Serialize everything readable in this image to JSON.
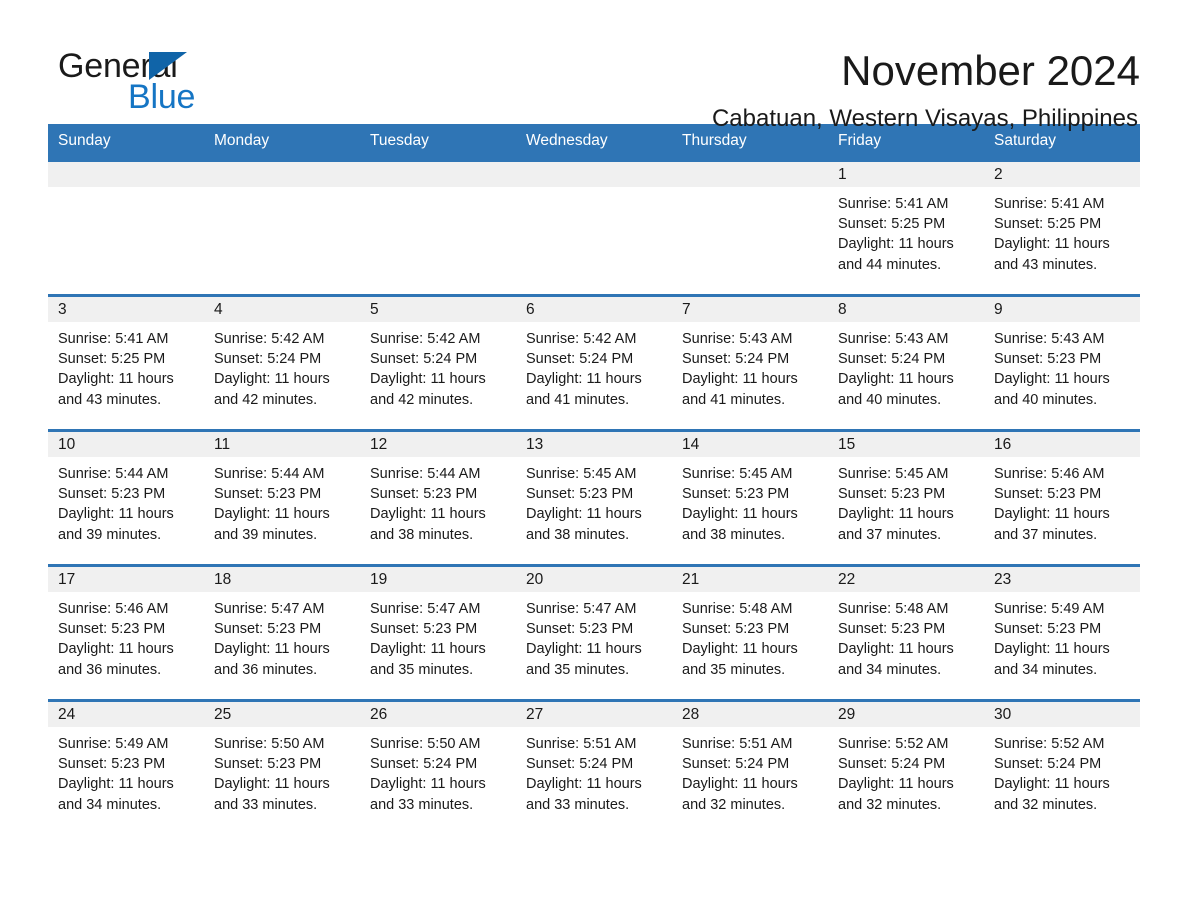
{
  "logo": {
    "text_top": "General",
    "text_bottom": "Blue",
    "triangle_color": "#1064a8",
    "blue_color": "#1575c4"
  },
  "header": {
    "month_title": "November 2024",
    "location": "Cabatuan, Western Visayas, Philippines"
  },
  "theme": {
    "header_blue": "#2f75b5",
    "daynum_band": "#f0f0f0",
    "text": "#1a1a1a"
  },
  "weekdays": [
    "Sunday",
    "Monday",
    "Tuesday",
    "Wednesday",
    "Thursday",
    "Friday",
    "Saturday"
  ],
  "weeks": [
    [
      {
        "day": "",
        "lines": []
      },
      {
        "day": "",
        "lines": []
      },
      {
        "day": "",
        "lines": []
      },
      {
        "day": "",
        "lines": []
      },
      {
        "day": "",
        "lines": []
      },
      {
        "day": "1",
        "lines": [
          "Sunrise: 5:41 AM",
          "Sunset: 5:25 PM",
          "Daylight: 11 hours",
          "and 44 minutes."
        ]
      },
      {
        "day": "2",
        "lines": [
          "Sunrise: 5:41 AM",
          "Sunset: 5:25 PM",
          "Daylight: 11 hours",
          "and 43 minutes."
        ]
      }
    ],
    [
      {
        "day": "3",
        "lines": [
          "Sunrise: 5:41 AM",
          "Sunset: 5:25 PM",
          "Daylight: 11 hours",
          "and 43 minutes."
        ]
      },
      {
        "day": "4",
        "lines": [
          "Sunrise: 5:42 AM",
          "Sunset: 5:24 PM",
          "Daylight: 11 hours",
          "and 42 minutes."
        ]
      },
      {
        "day": "5",
        "lines": [
          "Sunrise: 5:42 AM",
          "Sunset: 5:24 PM",
          "Daylight: 11 hours",
          "and 42 minutes."
        ]
      },
      {
        "day": "6",
        "lines": [
          "Sunrise: 5:42 AM",
          "Sunset: 5:24 PM",
          "Daylight: 11 hours",
          "and 41 minutes."
        ]
      },
      {
        "day": "7",
        "lines": [
          "Sunrise: 5:43 AM",
          "Sunset: 5:24 PM",
          "Daylight: 11 hours",
          "and 41 minutes."
        ]
      },
      {
        "day": "8",
        "lines": [
          "Sunrise: 5:43 AM",
          "Sunset: 5:24 PM",
          "Daylight: 11 hours",
          "and 40 minutes."
        ]
      },
      {
        "day": "9",
        "lines": [
          "Sunrise: 5:43 AM",
          "Sunset: 5:23 PM",
          "Daylight: 11 hours",
          "and 40 minutes."
        ]
      }
    ],
    [
      {
        "day": "10",
        "lines": [
          "Sunrise: 5:44 AM",
          "Sunset: 5:23 PM",
          "Daylight: 11 hours",
          "and 39 minutes."
        ]
      },
      {
        "day": "11",
        "lines": [
          "Sunrise: 5:44 AM",
          "Sunset: 5:23 PM",
          "Daylight: 11 hours",
          "and 39 minutes."
        ]
      },
      {
        "day": "12",
        "lines": [
          "Sunrise: 5:44 AM",
          "Sunset: 5:23 PM",
          "Daylight: 11 hours",
          "and 38 minutes."
        ]
      },
      {
        "day": "13",
        "lines": [
          "Sunrise: 5:45 AM",
          "Sunset: 5:23 PM",
          "Daylight: 11 hours",
          "and 38 minutes."
        ]
      },
      {
        "day": "14",
        "lines": [
          "Sunrise: 5:45 AM",
          "Sunset: 5:23 PM",
          "Daylight: 11 hours",
          "and 38 minutes."
        ]
      },
      {
        "day": "15",
        "lines": [
          "Sunrise: 5:45 AM",
          "Sunset: 5:23 PM",
          "Daylight: 11 hours",
          "and 37 minutes."
        ]
      },
      {
        "day": "16",
        "lines": [
          "Sunrise: 5:46 AM",
          "Sunset: 5:23 PM",
          "Daylight: 11 hours",
          "and 37 minutes."
        ]
      }
    ],
    [
      {
        "day": "17",
        "lines": [
          "Sunrise: 5:46 AM",
          "Sunset: 5:23 PM",
          "Daylight: 11 hours",
          "and 36 minutes."
        ]
      },
      {
        "day": "18",
        "lines": [
          "Sunrise: 5:47 AM",
          "Sunset: 5:23 PM",
          "Daylight: 11 hours",
          "and 36 minutes."
        ]
      },
      {
        "day": "19",
        "lines": [
          "Sunrise: 5:47 AM",
          "Sunset: 5:23 PM",
          "Daylight: 11 hours",
          "and 35 minutes."
        ]
      },
      {
        "day": "20",
        "lines": [
          "Sunrise: 5:47 AM",
          "Sunset: 5:23 PM",
          "Daylight: 11 hours",
          "and 35 minutes."
        ]
      },
      {
        "day": "21",
        "lines": [
          "Sunrise: 5:48 AM",
          "Sunset: 5:23 PM",
          "Daylight: 11 hours",
          "and 35 minutes."
        ]
      },
      {
        "day": "22",
        "lines": [
          "Sunrise: 5:48 AM",
          "Sunset: 5:23 PM",
          "Daylight: 11 hours",
          "and 34 minutes."
        ]
      },
      {
        "day": "23",
        "lines": [
          "Sunrise: 5:49 AM",
          "Sunset: 5:23 PM",
          "Daylight: 11 hours",
          "and 34 minutes."
        ]
      }
    ],
    [
      {
        "day": "24",
        "lines": [
          "Sunrise: 5:49 AM",
          "Sunset: 5:23 PM",
          "Daylight: 11 hours",
          "and 34 minutes."
        ]
      },
      {
        "day": "25",
        "lines": [
          "Sunrise: 5:50 AM",
          "Sunset: 5:23 PM",
          "Daylight: 11 hours",
          "and 33 minutes."
        ]
      },
      {
        "day": "26",
        "lines": [
          "Sunrise: 5:50 AM",
          "Sunset: 5:24 PM",
          "Daylight: 11 hours",
          "and 33 minutes."
        ]
      },
      {
        "day": "27",
        "lines": [
          "Sunrise: 5:51 AM",
          "Sunset: 5:24 PM",
          "Daylight: 11 hours",
          "and 33 minutes."
        ]
      },
      {
        "day": "28",
        "lines": [
          "Sunrise: 5:51 AM",
          "Sunset: 5:24 PM",
          "Daylight: 11 hours",
          "and 32 minutes."
        ]
      },
      {
        "day": "29",
        "lines": [
          "Sunrise: 5:52 AM",
          "Sunset: 5:24 PM",
          "Daylight: 11 hours",
          "and 32 minutes."
        ]
      },
      {
        "day": "30",
        "lines": [
          "Sunrise: 5:52 AM",
          "Sunset: 5:24 PM",
          "Daylight: 11 hours",
          "and 32 minutes."
        ]
      }
    ]
  ]
}
